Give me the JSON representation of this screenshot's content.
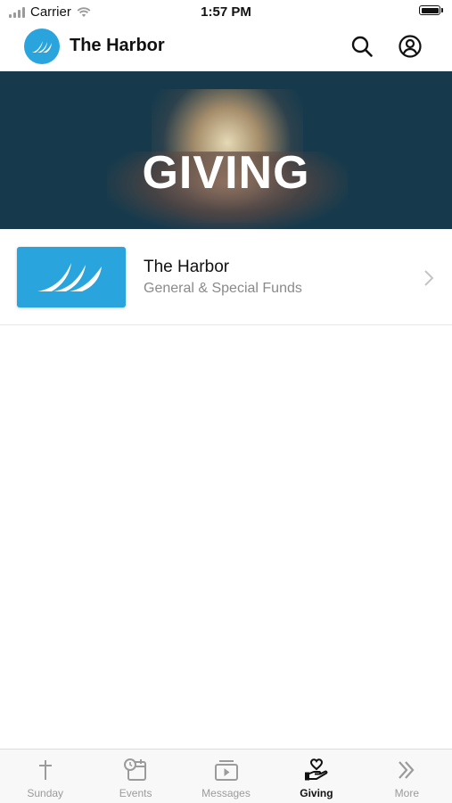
{
  "status_bar": {
    "carrier": "Carrier",
    "time": "1:57 PM"
  },
  "header": {
    "title": "The Harbor"
  },
  "hero": {
    "title": "GIVING"
  },
  "fund": {
    "name": "The Harbor",
    "subtitle": "General & Special Funds"
  },
  "tabs": [
    {
      "label": "Sunday",
      "icon": "cross-icon",
      "active": false
    },
    {
      "label": "Events",
      "icon": "calendar-clock-icon",
      "active": false
    },
    {
      "label": "Messages",
      "icon": "video-play-icon",
      "active": false
    },
    {
      "label": "Giving",
      "icon": "hand-heart-icon",
      "active": true
    },
    {
      "label": "More",
      "icon": "double-chevron-icon",
      "active": false
    }
  ],
  "colors": {
    "brand": "#2aa4dc",
    "hero_background": "#163a4c",
    "active_tab": "#111111",
    "inactive_tab": "#9b9b9b"
  }
}
